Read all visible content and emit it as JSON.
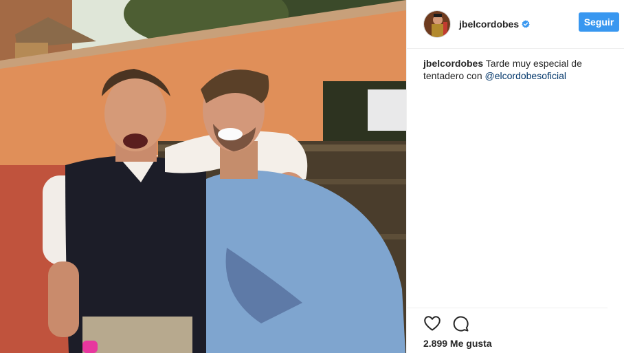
{
  "post": {
    "author": {
      "username": "jbelcordobes",
      "verified_icon": "verified-badge-icon",
      "avatar_icon": "avatar-bullfighter"
    },
    "follow_label": "Seguir",
    "caption": {
      "username": "jbelcordobes",
      "text": " Tarde muy especial de tentadero con ",
      "mention": "@elcordobesoficial"
    },
    "actions": {
      "like_icon": "heart-icon",
      "comment_icon": "comment-icon"
    },
    "likes": "2.899 Me gusta"
  },
  "colors": {
    "accent": "#3897f0",
    "mention": "#003569",
    "text": "#262626",
    "border": "#efefef"
  }
}
